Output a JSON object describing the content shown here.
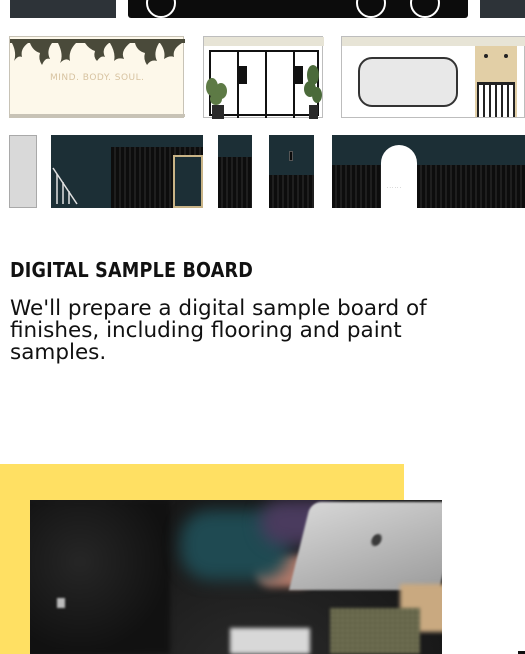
{
  "elevations": {
    "tagline": "MIND. BODY. SOUL.",
    "door_sign": "· · · · · ·"
  },
  "section": {
    "title": "DIGITAL SAMPLE BOARD",
    "description": "We'll prepare a digital sample board of finishes, including flooring and paint samples."
  },
  "colors": {
    "accent_yellow": "#ffe063",
    "dark_teal": "#1c2f36",
    "cream": "#fdf8ea",
    "beige_wall": "#e7e4d6"
  }
}
